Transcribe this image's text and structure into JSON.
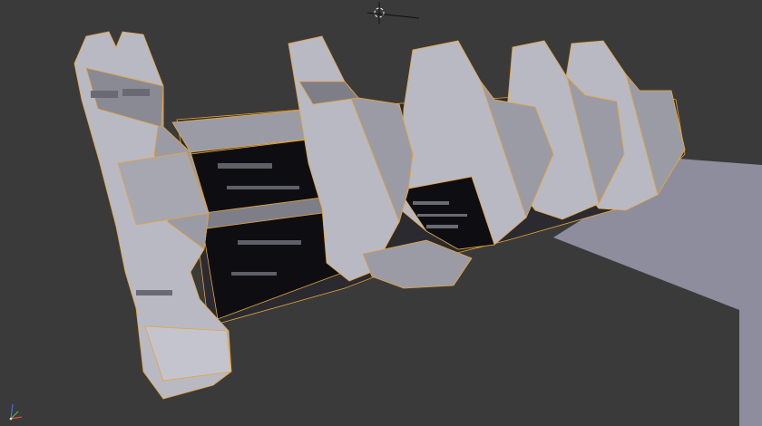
{
  "viewport": {
    "object_label": "",
    "background": "#3a3a3a",
    "colors": {
      "hull_light": "#b9b9c4",
      "hull_mid": "#9b9ba6",
      "hull_dark": "#7e7e89",
      "shadow": "#5f5f68",
      "panel_black": "#0e0e12",
      "selection_outline": "#e6a536",
      "ground_plane": "#8d8d9e"
    },
    "icons": [
      "3d-cursor-icon",
      "axis-gizmo-icon"
    ]
  }
}
